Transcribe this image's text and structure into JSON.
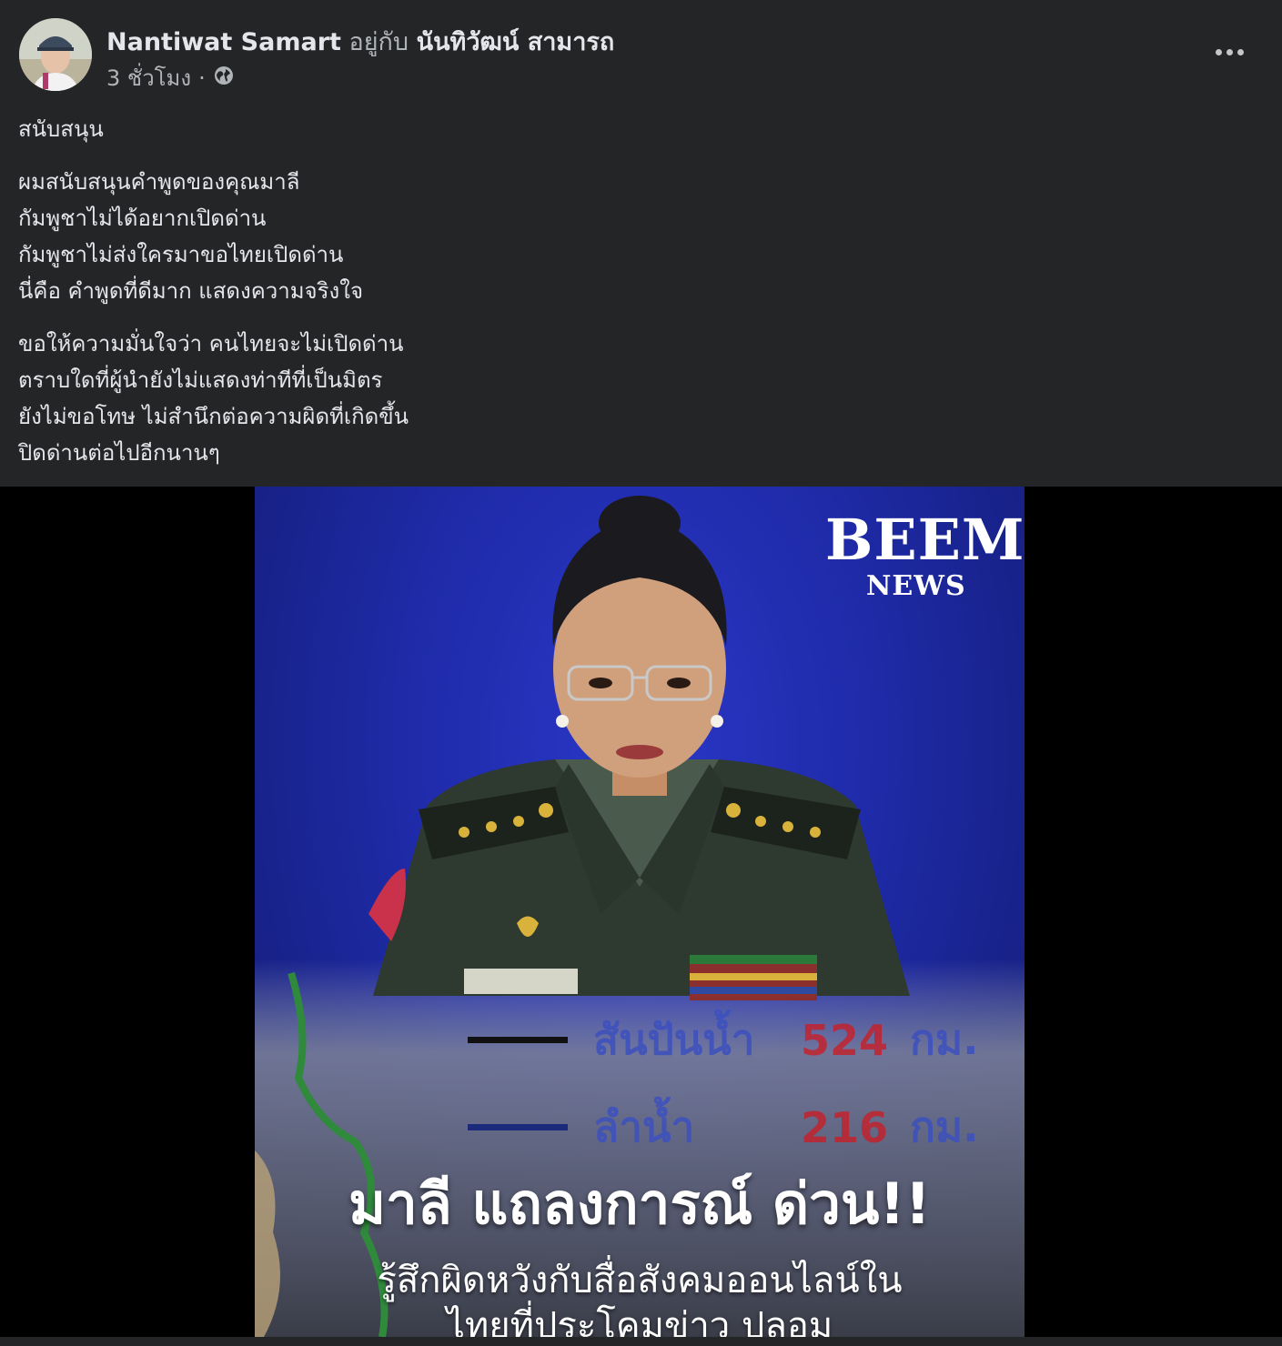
{
  "post": {
    "author_name": "Nantiwat Samart",
    "with_word": "อยู่กับ",
    "tagged_name": "นันทิวัฒน์ สามารถ",
    "timestamp": "3 ชั่วโมง",
    "separator": "·",
    "audience_icon": "globe-icon",
    "menu_icon": "more-options-icon",
    "body": {
      "p1": "สนับสนุน",
      "p2": [
        "ผมสนับสนุนคำพูดของคุณมาลี",
        "กัมพูชาไม่ได้อยากเปิดด่าน",
        "กัมพูชาไม่ส่งใครมาขอไทยเปิดด่าน",
        "นี่คือ คำพูดที่ดีมาก แสดงความจริงใจ"
      ],
      "p3": [
        "ขอให้ความมั่นใจว่า คนไทยจะไม่เปิดด่าน",
        "ตราบใดที่ผู้นำยังไม่แสดงท่าทีที่เป็นมิตร",
        "ยังไม่ขอโทษ ไม่สำนึกต่อความผิดที่เกิดขึ้น",
        "ปิดด่านต่อไปอีกนานๆ"
      ]
    }
  },
  "image": {
    "brand": "BEEM",
    "brand_sub": "NEWS",
    "map_rows": [
      {
        "label": "สันปันน้ำ",
        "value": "524",
        "unit": "กม."
      },
      {
        "label": "ลำน้ำ",
        "value": "216",
        "unit": "กม."
      }
    ],
    "headline": "มาลี แถลงการณ์ ด่วน!!",
    "subtitle_1": "รู้สึกผิดหวังกับสื่อสังคมออนไลน์ใน",
    "subtitle_2": "ไทยที่ประโคมข่าว ปลอม",
    "colors": {
      "background": "#242526",
      "text": "#e4e6eb",
      "secondary": "#b0b3b8",
      "photo_blue": "#1e2aa6"
    }
  }
}
